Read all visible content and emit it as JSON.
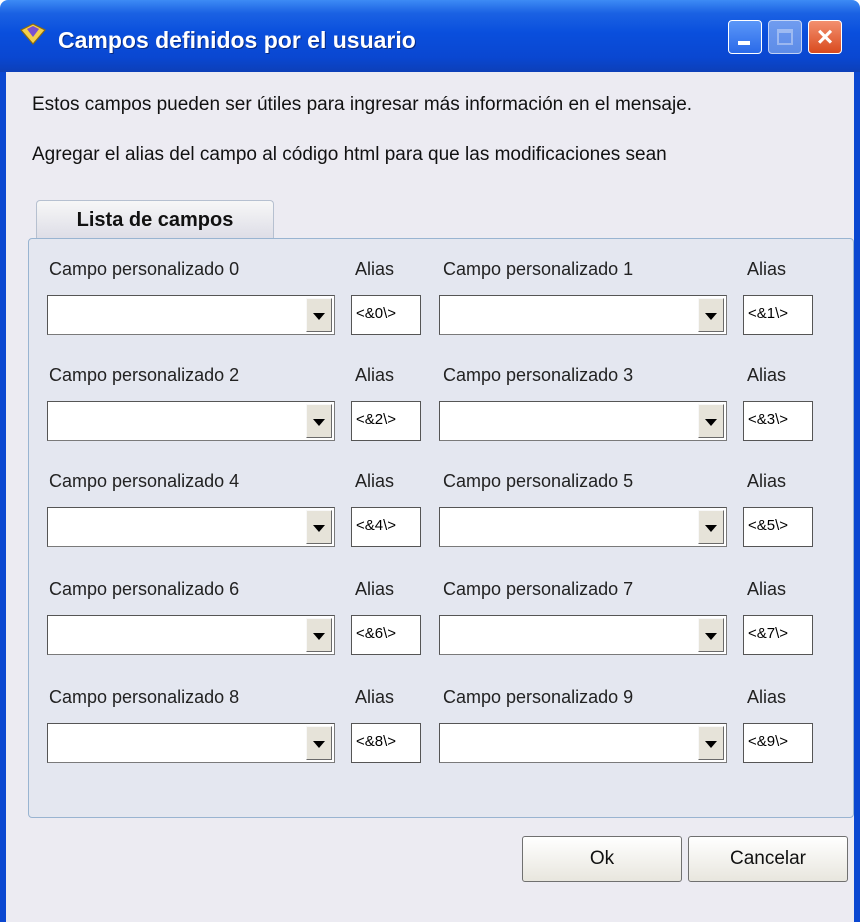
{
  "window": {
    "title": "Campos definidos por el usuario",
    "icon": "folder-pencil-icon",
    "accent_color": "#0a47d1"
  },
  "description": {
    "line1": "Estos campos pueden ser útiles para ingresar más información en el mensaje.",
    "line2": "Agregar el alias del campo al código html para que las modificaciones sean"
  },
  "tab": {
    "label": "Lista de campos"
  },
  "fields": [
    {
      "label": "Campo personalizado 0",
      "alias_label": "Alias",
      "alias": "<&0\\>",
      "value": ""
    },
    {
      "label": "Campo personalizado 1",
      "alias_label": "Alias",
      "alias": "<&1\\>",
      "value": ""
    },
    {
      "label": "Campo personalizado 2",
      "alias_label": "Alias",
      "alias": "<&2\\>",
      "value": ""
    },
    {
      "label": "Campo personalizado 3",
      "alias_label": "Alias",
      "alias": "<&3\\>",
      "value": ""
    },
    {
      "label": "Campo personalizado 4",
      "alias_label": "Alias",
      "alias": "<&4\\>",
      "value": ""
    },
    {
      "label": "Campo personalizado 5",
      "alias_label": "Alias",
      "alias": "<&5\\>",
      "value": ""
    },
    {
      "label": "Campo personalizado 6",
      "alias_label": "Alias",
      "alias": "<&6\\>",
      "value": ""
    },
    {
      "label": "Campo personalizado 7",
      "alias_label": "Alias",
      "alias": "<&7\\>",
      "value": ""
    },
    {
      "label": "Campo personalizado 8",
      "alias_label": "Alias",
      "alias": "<&8\\>",
      "value": ""
    },
    {
      "label": "Campo personalizado 9",
      "alias_label": "Alias",
      "alias": "<&9\\>",
      "value": ""
    }
  ],
  "buttons": {
    "ok": "Ok",
    "cancel": "Cancelar"
  }
}
